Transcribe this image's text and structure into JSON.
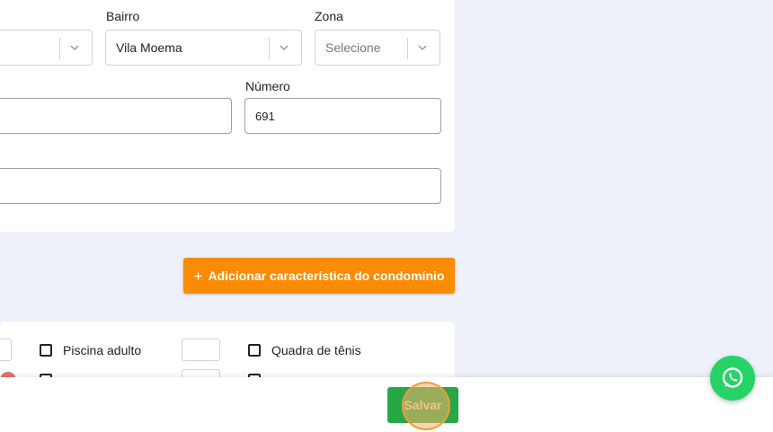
{
  "address": {
    "bairro_label": "Bairro",
    "bairro_value": "Vila Moema",
    "zona_label": "Zona",
    "zona_placeholder": "Selecione",
    "numero_label": "Número",
    "numero_value": "691"
  },
  "add_feature_button": "Adicionar característica do condomínio",
  "features": {
    "piscina_adulto": "Piscina adulto",
    "quadra_tenis": "Quadra de tênis"
  },
  "footer": {
    "save_label": "Salvar"
  },
  "colors": {
    "accent_orange": "#fb8c00",
    "save_green": "#28a745",
    "whatsapp_green": "#25d366"
  },
  "icons": [
    "chevron-down-icon",
    "plus-icon",
    "whatsapp-icon"
  ]
}
